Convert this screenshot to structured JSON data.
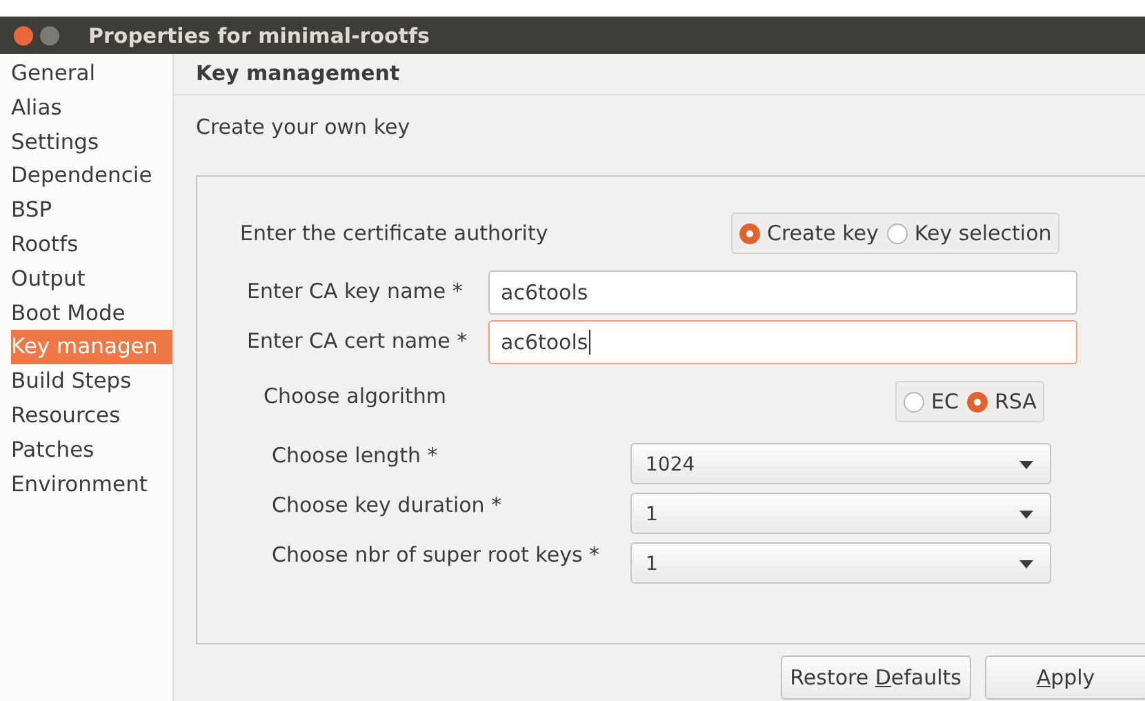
{
  "window": {
    "title": "Properties for minimal-rootfs"
  },
  "sidebar": {
    "items": [
      {
        "label": "General",
        "selected": false
      },
      {
        "label": "Alias",
        "selected": false
      },
      {
        "label": "Settings",
        "selected": false
      },
      {
        "label": "Dependencie",
        "selected": false
      },
      {
        "label": "BSP",
        "selected": false
      },
      {
        "label": "Rootfs",
        "selected": false
      },
      {
        "label": "Output",
        "selected": false
      },
      {
        "label": "Boot Mode",
        "selected": false
      },
      {
        "label": "Key managen",
        "selected": true
      },
      {
        "label": "Build Steps",
        "selected": false
      },
      {
        "label": "Resources",
        "selected": false
      },
      {
        "label": "Patches",
        "selected": false
      },
      {
        "label": "Environment",
        "selected": false
      }
    ]
  },
  "page": {
    "title": "Key management",
    "subtitle": "Create your own key",
    "authority": {
      "label": "Enter the certificate authority",
      "options": [
        {
          "label": "Create key",
          "selected": true
        },
        {
          "label": "Key selection",
          "selected": false
        }
      ]
    },
    "fields": [
      {
        "label": "Enter CA key name *",
        "value": "ac6tools",
        "focused": false
      },
      {
        "label": "Enter CA cert name *",
        "value": "ac6tools",
        "focused": true
      }
    ],
    "algorithm": {
      "label": "Choose algorithm",
      "options": [
        {
          "label": "EC",
          "selected": false
        },
        {
          "label": "RSA",
          "selected": true
        }
      ]
    },
    "selects": [
      {
        "label": "Choose length *",
        "value": "1024"
      },
      {
        "label": "Choose key duration *",
        "value": "1"
      },
      {
        "label": "Choose nbr of super root keys *",
        "value": "1"
      }
    ]
  },
  "buttons": [
    {
      "before": "Restore ",
      "mnemonic": "D",
      "after": "efaults"
    },
    {
      "mnemonic": "A",
      "after": "pply"
    }
  ]
}
